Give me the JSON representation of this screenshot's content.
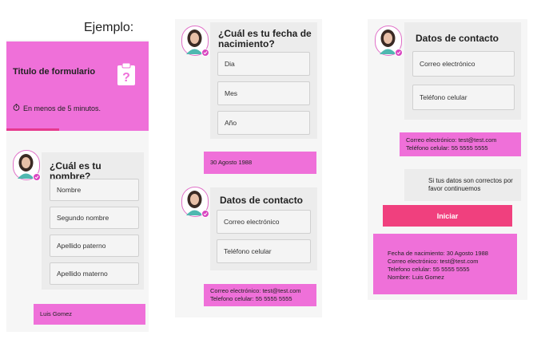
{
  "caption": "Ejemplo:",
  "panel1": {
    "form_title": "Titulo de formulario",
    "time_note": "En menos de 5 minutos.",
    "question": "¿Cuál es tu nombre?",
    "fields": [
      "Nombre",
      "Segundo nombre",
      "Apellido paterno",
      "Apellido materno"
    ],
    "answer": "Luis Gomez"
  },
  "panel2": {
    "question": "¿Cuál es tu fecha de nacimiento?",
    "fields": [
      "Dia",
      "Mes",
      "Año"
    ],
    "answer": "30 Agosto 1988",
    "contact_title": "Datos de contacto",
    "contact_fields": [
      "Correo electrónico",
      "Teléfono celular"
    ],
    "contact_answer": [
      "Correo electrónico: test@test.com",
      "Telefono celular: 55 5555 5555"
    ]
  },
  "panel3": {
    "contact_title": "Datos de contacto",
    "contact_fields": [
      "Correo electrónico",
      "Teléfono celular"
    ],
    "contact_answer": [
      "Correo electrónico: test@test.com",
      "Teléfono celular: 55 5555 5555"
    ],
    "confirm_text": "Si tus datos son correctos por favor continuemos",
    "start_button": "Iniciar",
    "summary": [
      "Fecha de nacimiento: 30 Agosto 1988",
      "Correo electrónico: test@test.com",
      "Telefono celular: 55 5555 5555",
      "Nombre: Luis Gomez"
    ]
  },
  "icons": [
    "clipboard-question-icon",
    "stopwatch-icon",
    "avatar-icon",
    "checkmark-badge-icon"
  ],
  "colors": {
    "accent_pink": "#ef70d9",
    "button_pink": "#f0407e",
    "progress": "#e6398e",
    "card_grey": "#ececec"
  }
}
